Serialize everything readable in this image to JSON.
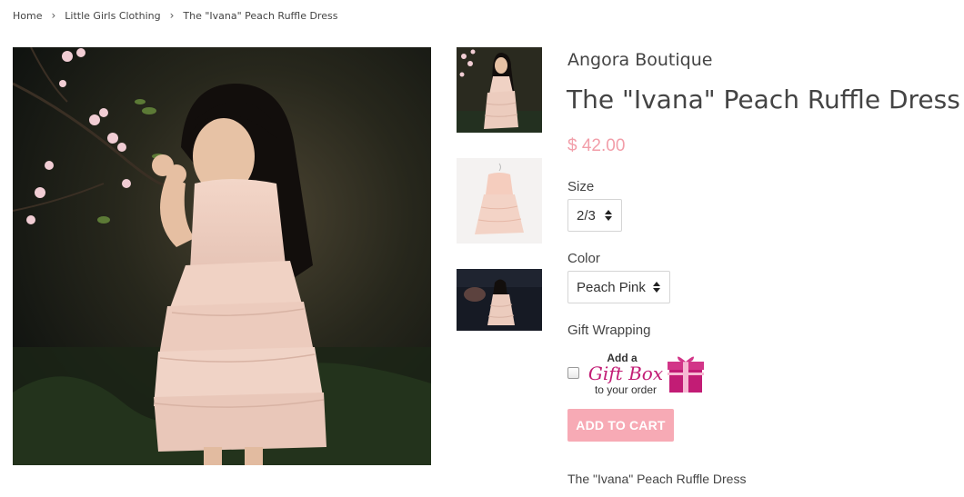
{
  "breadcrumb": {
    "home": "Home",
    "separator": "›",
    "category": "Little Girls Clothing",
    "current": "The \"Ivana\" Peach Ruffle Dress"
  },
  "product": {
    "vendor": "Angora Boutique",
    "title": "The \"Ivana\" Peach Ruffle Dress",
    "price": "$ 42.00",
    "description": "The \"Ivana\" Peach Ruffle Dress"
  },
  "options": {
    "size": {
      "label": "Size",
      "selected": "2/3"
    },
    "color": {
      "label": "Color",
      "selected": "Peach Pink"
    },
    "gift": {
      "label": "Gift Wrapping",
      "checked": false,
      "graphic_text": [
        "Add a",
        "Gift Box",
        "to your order"
      ]
    }
  },
  "add_to_cart": {
    "label": "ADD TO CART"
  },
  "colors": {
    "price": "#f29ea9",
    "button": "#f7aab5",
    "gift_magenta": "#c21c75"
  }
}
